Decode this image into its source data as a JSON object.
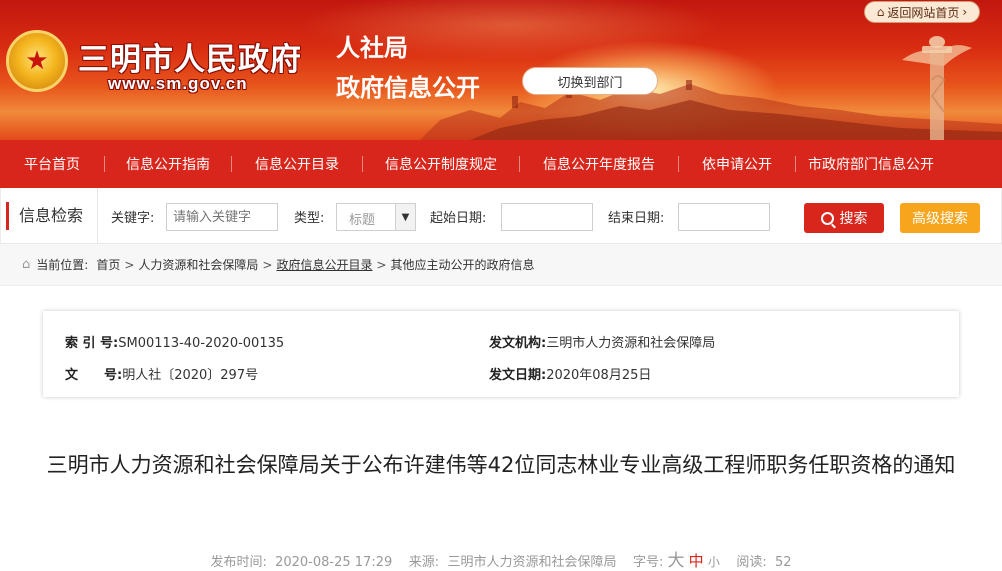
{
  "header": {
    "site_name": "三明市人民政府",
    "site_url": "www.sm.gov.cn",
    "dept_name": "人社局",
    "dept_subtitle": "政府信息公开",
    "switch_label": "切换到部门",
    "return_label": "返回网站首页",
    "return_arrow": "›",
    "emblem_glyph": "★",
    "colors": {
      "banner_red": "#c2170f",
      "nav_red": "#d8261c",
      "accent_orange": "#f7a51c"
    }
  },
  "nav": {
    "items": [
      "平台首页",
      "信息公开指南",
      "信息公开目录",
      "信息公开制度规定",
      "信息公开年度报告",
      "依申请公开",
      "市政府部门信息公开"
    ]
  },
  "search": {
    "section_title": "信息检索",
    "keyword_label": "关键字:",
    "keyword_placeholder": "请输入关键字",
    "type_label": "类型:",
    "type_value": "标题",
    "start_label": "起始日期:",
    "end_label": "结束日期:",
    "search_button": "搜索",
    "advanced_button": "高级搜索"
  },
  "breadcrumb": {
    "label": "当前位置:",
    "items": [
      "首页",
      "人力资源和社会保障局",
      "政府信息公开目录",
      "其他应主动公开的政府信息"
    ],
    "separator": ">"
  },
  "meta": {
    "index_key": "索 引 号:",
    "index_value": "SM00113-40-2020-00135",
    "doc_no_key": "文　　号:",
    "doc_no_value": "明人社〔2020〕297号",
    "issuer_key": "发文机构:",
    "issuer_value": "三明市人力资源和社会保障局",
    "date_key": "发文日期:",
    "date_value": "2020年08月25日"
  },
  "article": {
    "title": "三明市人力资源和社会保障局关于公布许建伟等42位同志林业专业高级工程师职务任职资格的通知",
    "publish_label": "发布时间:",
    "publish_time": "2020-08-25 17:29",
    "source_label": "来源:",
    "source": "三明市人力资源和社会保障局",
    "font_label": "字号:",
    "font_big": "大",
    "font_mid": "中",
    "font_small": "小",
    "views_label": "阅读:",
    "views": "52"
  }
}
